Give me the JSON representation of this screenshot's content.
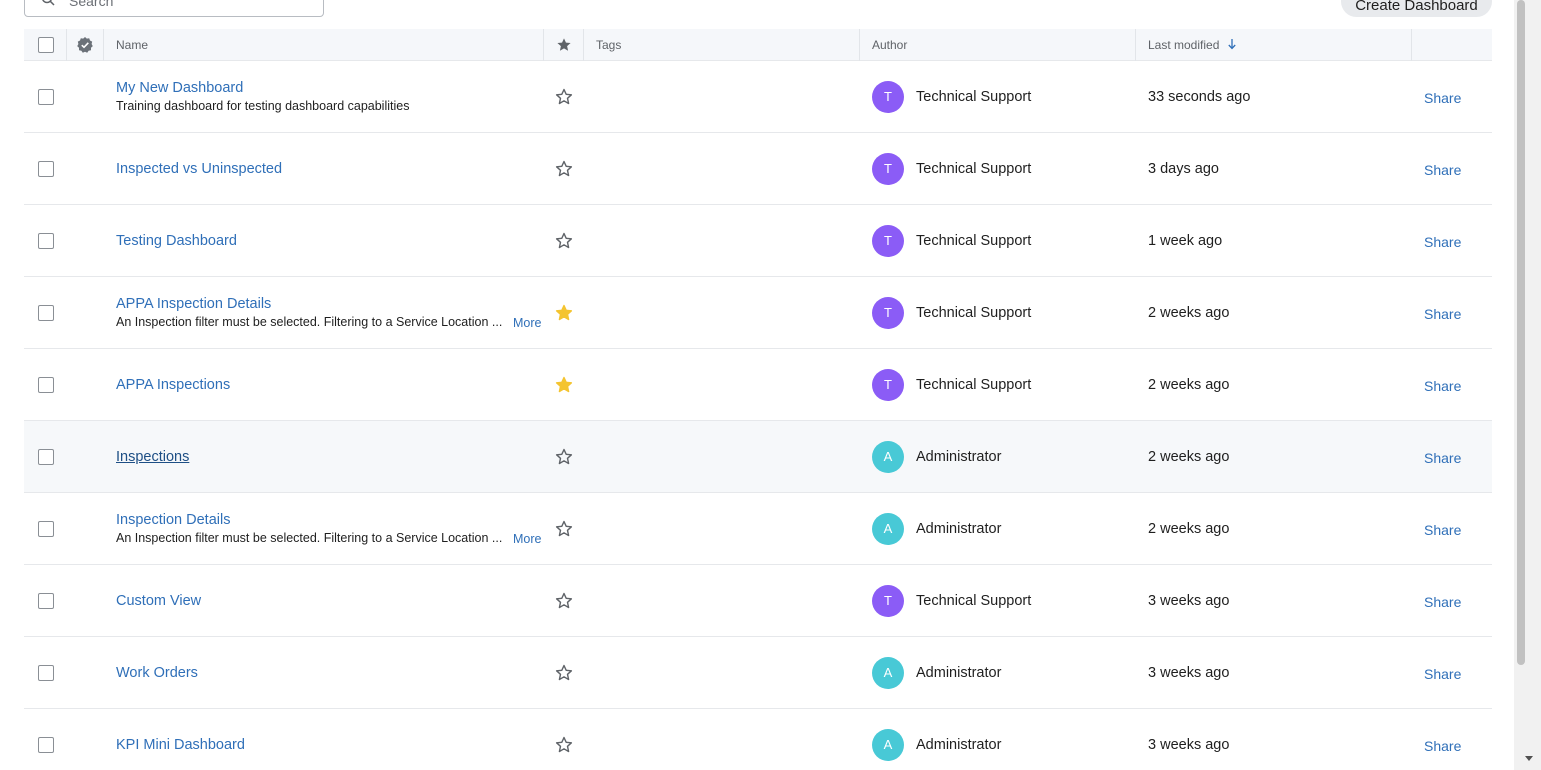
{
  "search": {
    "placeholder": "Search"
  },
  "create_button_label": "Create Dashboard",
  "header": {
    "name": "Name",
    "tags": "Tags",
    "author": "Author",
    "last_modified": "Last modified"
  },
  "more_label": "More",
  "share_label": "Share",
  "colors": {
    "link": "#2f6fb8",
    "star_filled": "#f4c430",
    "avatar_purple": "#8b5cf6",
    "avatar_teal": "#48c9d6"
  },
  "rows": [
    {
      "name": "My New Dashboard",
      "description": "Training dashboard for testing dashboard capabilities",
      "starred": false,
      "avatar": "T",
      "author": "Technical Support",
      "modified": "33 seconds ago"
    },
    {
      "name": "Inspected vs Uninspected",
      "description": "",
      "starred": false,
      "avatar": "T",
      "author": "Technical Support",
      "modified": "3 days ago"
    },
    {
      "name": "Testing Dashboard",
      "description": "",
      "starred": false,
      "avatar": "T",
      "author": "Technical Support",
      "modified": "1 week ago"
    },
    {
      "name": "APPA Inspection Details",
      "description": "An Inspection filter must be selected. Filtering to a Service Location ...",
      "starred": true,
      "avatar": "T",
      "author": "Technical Support",
      "modified": "2 weeks ago"
    },
    {
      "name": "APPA Inspections",
      "description": "",
      "starred": true,
      "avatar": "T",
      "author": "Technical Support",
      "modified": "2 weeks ago"
    },
    {
      "name": "Inspections",
      "description": "",
      "starred": false,
      "avatar": "A",
      "author": "Administrator",
      "modified": "2 weeks ago"
    },
    {
      "name": "Inspection Details",
      "description": "An Inspection filter must be selected. Filtering to a Service Location ...",
      "starred": false,
      "avatar": "A",
      "author": "Administrator",
      "modified": "2 weeks ago"
    },
    {
      "name": "Custom View",
      "description": "",
      "starred": false,
      "avatar": "T",
      "author": "Technical Support",
      "modified": "3 weeks ago"
    },
    {
      "name": "Work Orders",
      "description": "",
      "starred": false,
      "avatar": "A",
      "author": "Administrator",
      "modified": "3 weeks ago"
    },
    {
      "name": "KPI Mini Dashboard",
      "description": "",
      "starred": false,
      "avatar": "A",
      "author": "Administrator",
      "modified": "3 weeks ago"
    }
  ]
}
